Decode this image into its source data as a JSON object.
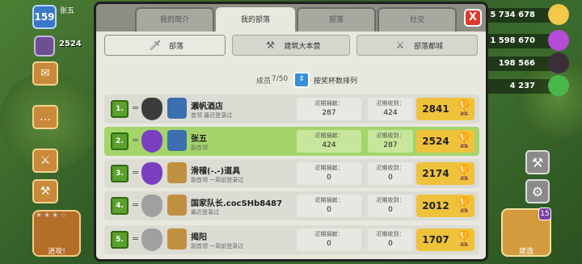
{
  "player": {
    "level": "159",
    "name": "张五",
    "trophies": "2524"
  },
  "resources": [
    {
      "value": "5 734 678",
      "color": "#f2c84a"
    },
    {
      "value": "1 598 670",
      "color": "#b54bd6"
    },
    {
      "value": "198 566",
      "color": "#3b2e3a"
    },
    {
      "value": "4 237",
      "color": "#49b84a"
    }
  ],
  "tabs": [
    "我的简介",
    "我的部落",
    "部落",
    "社交"
  ],
  "close_label": "X",
  "subtabs": [
    "部落",
    "建筑大本营",
    "部落都城"
  ],
  "members": {
    "label": "成员",
    "count": "7/50",
    "sort_label": "按奖杯数排列"
  },
  "stat_labels": {
    "given": "近期捐献：",
    "received": "近期收到："
  },
  "rows": [
    {
      "rank": "1.",
      "name": "瀬帆酒店",
      "role": "首领  最近登录过",
      "given": "287",
      "received": "424",
      "trophies": "2841",
      "self": false,
      "league_color": "#3b3b3b",
      "th_color": "#3b6fb0",
      "badge": "5"
    },
    {
      "rank": "2.",
      "name": "张五",
      "role": "副首领",
      "given": "424",
      "received": "287",
      "trophies": "2524",
      "self": true,
      "league_color": "#7a3fc0",
      "th_color": "#3b6fb0",
      "badge": "1"
    },
    {
      "rank": "3.",
      "name": "滑稽(-.-)道具",
      "role": "副首领  一周前登录过",
      "given": "0",
      "received": "0",
      "trophies": "2174",
      "self": false,
      "league_color": "#7a3fc0",
      "th_color": "#c09040",
      "badge": "3"
    },
    {
      "rank": "4.",
      "name": "国家队长.cocSHb8487",
      "role": "最近登录过",
      "given": "0",
      "received": "0",
      "trophies": "2012",
      "self": false,
      "league_color": "#a0a0a0",
      "th_color": "#c09040",
      "badge": ""
    },
    {
      "rank": "5.",
      "name": "揭阳",
      "role": "副首领  一周前登录过",
      "given": "0",
      "received": "0",
      "trophies": "1707",
      "self": false,
      "league_color": "#a0a0a0",
      "th_color": "#c09040",
      "badge": ""
    }
  ],
  "build_label": "建造",
  "build_badge": "15",
  "scroll_label": "进攻!"
}
